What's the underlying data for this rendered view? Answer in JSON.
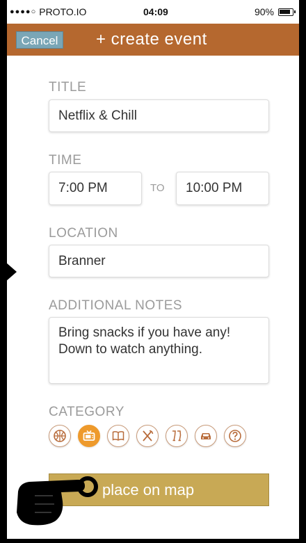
{
  "status_bar": {
    "signal_dots": "●●●●○",
    "carrier": "PROTO.IO",
    "time": "04:09",
    "battery_percent": "90%"
  },
  "nav": {
    "cancel_label": "Cancel",
    "title": "+ create event"
  },
  "form": {
    "title_label": "TITLE",
    "title_value": "Netflix & Chill",
    "time_label": "TIME",
    "time_start": "7:00 PM",
    "time_separator": "TO",
    "time_end": "10:00 PM",
    "location_label": "LOCATION",
    "location_value": "Branner",
    "notes_label": "ADDITIONAL NOTES",
    "notes_value": "Bring snacks if you have any! Down to watch anything.",
    "category_label": "CATEGORY",
    "categories": [
      {
        "icon": "basketball-icon",
        "selected": false
      },
      {
        "icon": "tv-icon",
        "selected": true
      },
      {
        "icon": "book-icon",
        "selected": false
      },
      {
        "icon": "utensils-icon",
        "selected": false
      },
      {
        "icon": "cheers-icon",
        "selected": false
      },
      {
        "icon": "car-icon",
        "selected": false
      },
      {
        "icon": "question-icon",
        "selected": false
      }
    ]
  },
  "map_button": {
    "label": "place on map"
  },
  "colors": {
    "nav_bg": "#b5682f",
    "cancel_bg": "#7aa6b6",
    "category_selected": "#ee9a2c",
    "category_border": "#c99b7a",
    "map_button_bg": "#c8a955",
    "label_gray": "#9b9b9b"
  },
  "overlay": {
    "cursor": "hand-pointer-icon"
  }
}
